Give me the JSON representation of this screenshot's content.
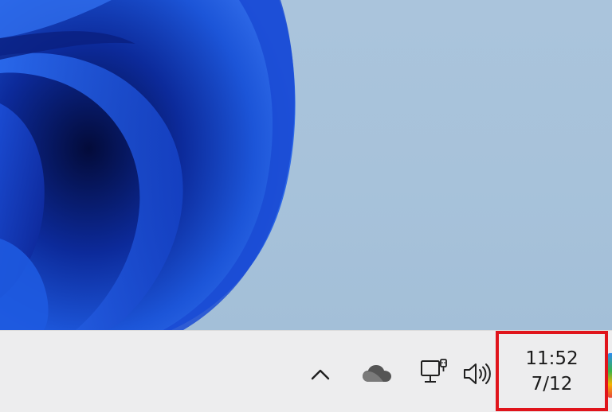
{
  "desktop": {
    "wallpaper": "windows-11-bloom",
    "colors": {
      "background": "#a8c3db",
      "bloom_dark": "#0a1e7a",
      "bloom_mid": "#1a4fd0",
      "bloom_light": "#3a78f2"
    }
  },
  "taskbar": {
    "background": "#ededee",
    "tray": {
      "chevron_icon": "chevron-up-icon",
      "onedrive_icon": "cloud-icon",
      "network_icon": "wired-network-icon",
      "volume_icon": "speaker-volume-icon"
    },
    "clock": {
      "time": "11:52",
      "date": "7/12",
      "highlight_color": "#e0141b"
    }
  }
}
